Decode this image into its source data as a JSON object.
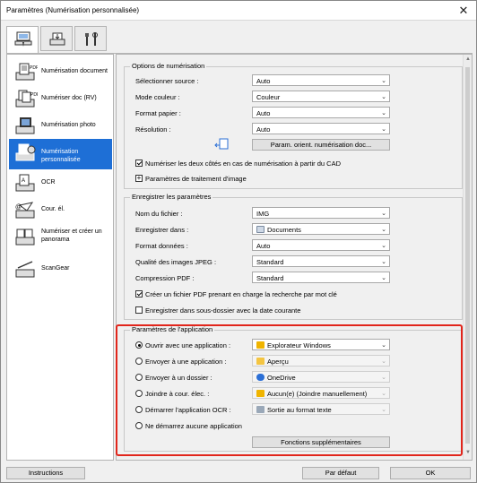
{
  "window": {
    "title": "Paramètres (Numérisation personnalisée)",
    "close_glyph": "✕"
  },
  "tabs": [
    {
      "icon": "scan-from-computer-icon",
      "active": true
    },
    {
      "icon": "scan-from-operation-panel-icon",
      "active": false
    },
    {
      "icon": "general-settings-icon",
      "active": false
    }
  ],
  "sidebar": {
    "items": [
      {
        "label": "Numérisation document",
        "icon": "document-scan-icon"
      },
      {
        "label": "Numériser doc (RV)",
        "icon": "duplex-document-scan-icon"
      },
      {
        "label": "Numérisation photo",
        "icon": "photo-scan-icon"
      },
      {
        "label": "Numérisation personnalisée",
        "icon": "custom-scan-icon",
        "active": true
      },
      {
        "label": "OCR",
        "icon": "ocr-icon"
      },
      {
        "label": "Cour. él.",
        "icon": "email-icon"
      },
      {
        "label": "Numériser et créer un panorama",
        "icon": "panorama-icon"
      },
      {
        "label": "ScanGear",
        "icon": "scangear-icon"
      }
    ]
  },
  "scan_options": {
    "title": "Options de numérisation",
    "rows": [
      {
        "label": "Sélectionner source :",
        "value": "Auto"
      },
      {
        "label": "Mode couleur :",
        "value": "Couleur"
      },
      {
        "label": "Format papier :",
        "value": "Auto"
      },
      {
        "label": "Résolution :",
        "value": "Auto"
      }
    ],
    "orientation_button": "Param. orient. numérisation doc...",
    "duplex_adf_checkbox": "Numériser les deux côtés en cas de numérisation à partir du CAD",
    "duplex_adf_checked": true,
    "image_processing_toggle": "+",
    "image_processing_label": "Paramètres de traitement d'image"
  },
  "save_settings": {
    "title": "Enregistrer les paramètres",
    "rows": [
      {
        "label": "Nom du fichier :",
        "value": "IMG"
      },
      {
        "label": "Enregistrer dans :",
        "value": "Documents"
      },
      {
        "label": "Format données :",
        "value": "Auto"
      },
      {
        "label": "Qualité des images JPEG :",
        "value": "Standard"
      },
      {
        "label": "Compression PDF :",
        "value": "Standard"
      }
    ],
    "searchable_pdf_checkbox": "Créer un fichier PDF prenant en charge la recherche par mot clé",
    "searchable_pdf_checked": true,
    "date_subfolder_checkbox": "Enregistrer dans sous-dossier avec la date courante",
    "date_subfolder_checked": false
  },
  "app_settings": {
    "title": "Paramètres de l'application",
    "options": [
      {
        "label": "Ouvrir avec une application :",
        "value": "Explorateur Windows",
        "selected": true,
        "enabled": true,
        "icon_color": "#f0b400"
      },
      {
        "label": "Envoyer à une application :",
        "value": "Aperçu",
        "selected": false,
        "enabled": false,
        "icon_color": "#f4c542"
      },
      {
        "label": "Envoyer à un dossier :",
        "value": "OneDrive",
        "selected": false,
        "enabled": false,
        "icon_color": "#2b6fd6"
      },
      {
        "label": "Joindre à cour. élec. :",
        "value": "Aucun(e) (Joindre manuellement)",
        "selected": false,
        "enabled": false,
        "icon_color": "#f0b400"
      },
      {
        "label": "Démarrer l'application OCR :",
        "value": "Sortie au format texte",
        "selected": false,
        "enabled": false,
        "icon_color": "#9aa8b8"
      },
      {
        "label": "Ne démarrez aucune application",
        "selected": false
      }
    ],
    "more_functions_button": "Fonctions supplémentaires"
  },
  "footer": {
    "instructions": "Instructions",
    "defaults": "Par défaut",
    "ok": "OK"
  },
  "colors": {
    "accent": "#1e6fd6",
    "highlight_border": "#e1251b"
  }
}
